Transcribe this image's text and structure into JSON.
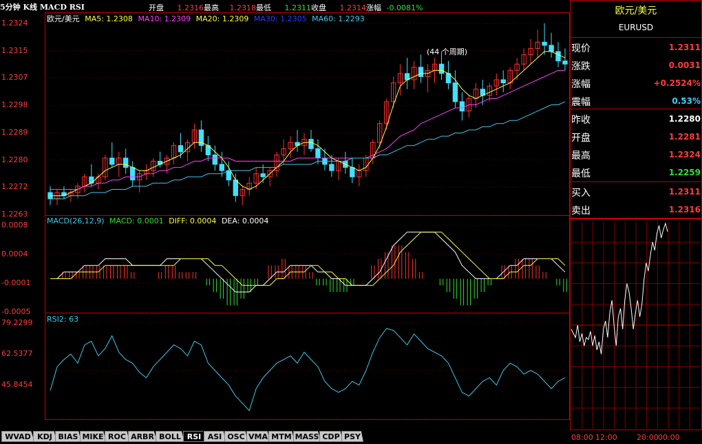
{
  "title": "5分钟 K线 MACD RSI",
  "header": {
    "open_label": "开盘",
    "open": "1.2316",
    "high_label": "最高",
    "high": "1.2318",
    "low_label": "最低",
    "low": "1.2311",
    "close_label": "收盘",
    "close": "1.2314",
    "change_label": "涨幅",
    "change": "-0.0081%"
  },
  "main_legend": {
    "symbol": "欧元/美元",
    "ma5": "MA5: 1.2308",
    "ma10": "MA10: 1.2309",
    "ma20": "MA20: 1.2309",
    "ma30": "MA30: 1.2305",
    "ma60": "MA60: 1.2293"
  },
  "period_note": "(44 个周期)",
  "macd_legend": {
    "name": "MACD(26,12,9)",
    "macd": "MACD: 0.0001",
    "diff": "DIFF: 0.0004",
    "dea": "DEA: 0.0004"
  },
  "rsi_legend": {
    "name": "RSI2: 63"
  },
  "side": {
    "name": "欧元/美元",
    "code": "EURUSD",
    "rows": [
      {
        "label": "现价",
        "value": "1.2311",
        "color": "#ff3b3b"
      },
      {
        "label": "涨跌",
        "value": "0.0031",
        "color": "#ff3b3b"
      },
      {
        "label": "涨幅",
        "value": "+0.2524%",
        "color": "#ff3b3b"
      },
      {
        "label": "震幅",
        "value": "0.53%",
        "color": "#40d0ff"
      },
      {
        "label": "昨收",
        "value": "1.2280",
        "color": "#ffffff"
      },
      {
        "label": "开盘",
        "value": "1.2281",
        "color": "#ff3b3b"
      },
      {
        "label": "最高",
        "value": "1.2324",
        "color": "#ff3b3b"
      },
      {
        "label": "最低",
        "value": "1.2259",
        "color": "#30e030"
      },
      {
        "label": "买入",
        "value": "1.2311",
        "color": "#ff3b3b"
      },
      {
        "label": "卖出",
        "value": "1.2316",
        "color": "#ff3b3b"
      }
    ],
    "time_start": "08:00",
    "time_mid": "12:00",
    "time_end": "20:00",
    "time_tail": "00:00"
  },
  "tabs": [
    "WVAD",
    "KDJ",
    "BIAS",
    "MIKE",
    "ROC",
    "ARBR",
    "BOLL",
    "RSI",
    "ASI",
    "OSC",
    "VMA",
    "MTM",
    "MASS",
    "CDP",
    "PSY"
  ],
  "active_tab": "RSI",
  "colors": {
    "up": "#ff3030",
    "down": "#40e0ff",
    "frame": "#c00000",
    "ma5": "#ffffff",
    "ma10": "#ffff40",
    "ma20": "#ff40ff",
    "ma30": "#00c000",
    "ma60": "#2040ff",
    "diff": "#ffffff",
    "dea": "#ffff40",
    "macd_up": "#ff3030",
    "macd_down": "#30e030",
    "rsi": "#40c8e8"
  },
  "chart_data": [
    {
      "type": "candlestick",
      "name": "欧元/美元",
      "yticks": [
        "1.2324",
        "1.2315",
        "1.2307",
        "1.2298",
        "1.2289",
        "1.2280",
        "1.2272",
        "1.2263"
      ],
      "ylim": [
        1.2263,
        1.2324
      ],
      "ohlc": [
        [
          1.227,
          1.2272,
          1.2266,
          1.2268
        ],
        [
          1.2268,
          1.2271,
          1.2266,
          1.227
        ],
        [
          1.227,
          1.2272,
          1.2268,
          1.2269
        ],
        [
          1.2269,
          1.2271,
          1.2267,
          1.227
        ],
        [
          1.227,
          1.2273,
          1.2268,
          1.2272
        ],
        [
          1.2272,
          1.2276,
          1.227,
          1.2275
        ],
        [
          1.2275,
          1.2279,
          1.2272,
          1.2273
        ],
        [
          1.2273,
          1.2276,
          1.2271,
          1.2275
        ],
        [
          1.2275,
          1.2282,
          1.2274,
          1.2281
        ],
        [
          1.2281,
          1.2286,
          1.2278,
          1.2279
        ],
        [
          1.2279,
          1.2283,
          1.2275,
          1.2281
        ],
        [
          1.2281,
          1.2284,
          1.2276,
          1.2278
        ],
        [
          1.2278,
          1.228,
          1.2272,
          1.2274
        ],
        [
          1.2274,
          1.2277,
          1.227,
          1.2276
        ],
        [
          1.2276,
          1.2279,
          1.2274,
          1.2277
        ],
        [
          1.2277,
          1.2281,
          1.2275,
          1.228
        ],
        [
          1.228,
          1.2283,
          1.2278,
          1.2279
        ],
        [
          1.2279,
          1.2282,
          1.2276,
          1.2281
        ],
        [
          1.2281,
          1.2286,
          1.2279,
          1.2285
        ],
        [
          1.2285,
          1.2289,
          1.2281,
          1.2283
        ],
        [
          1.2283,
          1.2287,
          1.228,
          1.2286
        ],
        [
          1.2286,
          1.2292,
          1.2284,
          1.229
        ],
        [
          1.229,
          1.2293,
          1.2283,
          1.2285
        ],
        [
          1.2285,
          1.2288,
          1.228,
          1.2282
        ],
        [
          1.2282,
          1.2285,
          1.2277,
          1.2279
        ],
        [
          1.2279,
          1.2283,
          1.2275,
          1.2277
        ],
        [
          1.2277,
          1.228,
          1.2272,
          1.2274
        ],
        [
          1.2274,
          1.2276,
          1.2267,
          1.2269
        ],
        [
          1.2269,
          1.2272,
          1.2266,
          1.2271
        ],
        [
          1.2271,
          1.2275,
          1.2269,
          1.2273
        ],
        [
          1.2273,
          1.2278,
          1.2271,
          1.2276
        ],
        [
          1.2276,
          1.2279,
          1.2273,
          1.2275
        ],
        [
          1.2275,
          1.2278,
          1.2272,
          1.2277
        ],
        [
          1.2277,
          1.2283,
          1.2275,
          1.2282
        ],
        [
          1.2282,
          1.2287,
          1.2279,
          1.2284
        ],
        [
          1.2284,
          1.2288,
          1.2281,
          1.2286
        ],
        [
          1.2286,
          1.229,
          1.2283,
          1.2285
        ],
        [
          1.2285,
          1.2289,
          1.2282,
          1.2287
        ],
        [
          1.2287,
          1.229,
          1.2283,
          1.2284
        ],
        [
          1.2284,
          1.2287,
          1.2279,
          1.2281
        ],
        [
          1.2281,
          1.2284,
          1.2277,
          1.2279
        ],
        [
          1.2279,
          1.2282,
          1.2275,
          1.2277
        ],
        [
          1.2277,
          1.2281,
          1.2274,
          1.228
        ],
        [
          1.228,
          1.2283,
          1.2276,
          1.2278
        ],
        [
          1.2278,
          1.2281,
          1.2273,
          1.2275
        ],
        [
          1.2275,
          1.2279,
          1.2272,
          1.2277
        ],
        [
          1.2277,
          1.2282,
          1.2275,
          1.2281
        ],
        [
          1.2281,
          1.2287,
          1.2279,
          1.2286
        ],
        [
          1.2286,
          1.2293,
          1.2284,
          1.2292
        ],
        [
          1.2292,
          1.23,
          1.229,
          1.2299
        ],
        [
          1.2299,
          1.2307,
          1.2297,
          1.2305
        ],
        [
          1.2305,
          1.2311,
          1.2301,
          1.2308
        ],
        [
          1.2308,
          1.2313,
          1.2303,
          1.2306
        ],
        [
          1.2306,
          1.2312,
          1.2303,
          1.231
        ],
        [
          1.231,
          1.2314,
          1.2305,
          1.2307
        ],
        [
          1.2307,
          1.2311,
          1.2302,
          1.2309
        ],
        [
          1.2309,
          1.2313,
          1.2305,
          1.2311
        ],
        [
          1.2311,
          1.2315,
          1.2306,
          1.2308
        ],
        [
          1.2308,
          1.2312,
          1.2303,
          1.2305
        ],
        [
          1.2305,
          1.2309,
          1.2297,
          1.2299
        ],
        [
          1.2299,
          1.2302,
          1.2293,
          1.2296
        ],
        [
          1.2296,
          1.2301,
          1.2294,
          1.23
        ],
        [
          1.23,
          1.2305,
          1.2297,
          1.2303
        ],
        [
          1.2303,
          1.2306,
          1.2298,
          1.2301
        ],
        [
          1.2301,
          1.2305,
          1.2299,
          1.2304
        ],
        [
          1.2304,
          1.2308,
          1.2301,
          1.2306
        ],
        [
          1.2306,
          1.2309,
          1.2302,
          1.2305
        ],
        [
          1.2305,
          1.231,
          1.2303,
          1.2309
        ],
        [
          1.2309,
          1.2313,
          1.2306,
          1.2311
        ],
        [
          1.2311,
          1.2316,
          1.2309,
          1.2314
        ],
        [
          1.2314,
          1.2319,
          1.2311,
          1.2316
        ],
        [
          1.2316,
          1.2322,
          1.2313,
          1.2318
        ],
        [
          1.2318,
          1.2324,
          1.2314,
          1.2317
        ],
        [
          1.2317,
          1.2321,
          1.2313,
          1.2315
        ],
        [
          1.2315,
          1.2318,
          1.231,
          1.2312
        ],
        [
          1.2312,
          1.2316,
          1.2309,
          1.2311
        ]
      ],
      "ma5": [
        1.2269,
        1.2269,
        1.2269,
        1.227,
        1.2271,
        1.2272,
        1.2273,
        1.2275,
        1.2277,
        1.2278,
        1.2279,
        1.2279,
        1.2278,
        1.2277,
        1.2277,
        1.2278,
        1.2279,
        1.228,
        1.2281,
        1.2282,
        1.2284,
        1.2286,
        1.2286,
        1.2285,
        1.2283,
        1.2281,
        1.2278,
        1.2274,
        1.2272,
        1.2271,
        1.2272,
        1.2274,
        1.2276,
        1.2278,
        1.228,
        1.2283,
        1.2285,
        1.2286,
        1.2286,
        1.2285,
        1.2283,
        1.2281,
        1.228,
        1.2279,
        1.2278,
        1.2277,
        1.2278,
        1.2281,
        1.2285,
        1.2291,
        1.2298,
        1.2304,
        1.2306,
        1.2307,
        1.2308,
        1.2308,
        1.2309,
        1.2309,
        1.2308,
        1.2306,
        1.2303,
        1.2301,
        1.23,
        1.2301,
        1.2302,
        1.2303,
        1.2304,
        1.2305,
        1.2307,
        1.2309,
        1.2311,
        1.2313,
        1.2315,
        1.2315,
        1.2314,
        1.2313
      ],
      "ma20": [
        1.2271,
        1.2271,
        1.2271,
        1.2271,
        1.2271,
        1.2272,
        1.2272,
        1.2273,
        1.2273,
        1.2274,
        1.2274,
        1.2275,
        1.2275,
        1.2275,
        1.2276,
        1.2276,
        1.2277,
        1.2277,
        1.2278,
        1.2278,
        1.2279,
        1.228,
        1.228,
        1.2281,
        1.2281,
        1.2281,
        1.2281,
        1.228,
        1.228,
        1.228,
        1.228,
        1.228,
        1.228,
        1.228,
        1.228,
        1.228,
        1.2281,
        1.2281,
        1.2281,
        1.2281,
        1.2281,
        1.2281,
        1.2281,
        1.2281,
        1.2281,
        1.2281,
        1.2281,
        1.2282,
        1.2283,
        1.2284,
        1.2286,
        1.2288,
        1.2289,
        1.229,
        1.2292,
        1.2293,
        1.2294,
        1.2295,
        1.2296,
        1.2297,
        1.2297,
        1.2298,
        1.2298,
        1.2299,
        1.23,
        1.23,
        1.2301,
        1.2302,
        1.2303,
        1.2304,
        1.2305,
        1.2306,
        1.2307,
        1.2308,
        1.2309,
        1.2309
      ],
      "ma60": [
        1.2268,
        1.2268,
        1.2268,
        1.2269,
        1.2269,
        1.2269,
        1.227,
        1.227,
        1.227,
        1.2271,
        1.2271,
        1.2271,
        1.2272,
        1.2272,
        1.2272,
        1.2273,
        1.2273,
        1.2273,
        1.2274,
        1.2274,
        1.2275,
        1.2275,
        1.2275,
        1.2276,
        1.2276,
        1.2276,
        1.2277,
        1.2277,
        1.2277,
        1.2277,
        1.2278,
        1.2278,
        1.2278,
        1.2278,
        1.2279,
        1.2279,
        1.2279,
        1.2279,
        1.2279,
        1.228,
        1.228,
        1.228,
        1.228,
        1.228,
        1.2281,
        1.2281,
        1.2281,
        1.2281,
        1.2282,
        1.2282,
        1.2283,
        1.2284,
        1.2285,
        1.2285,
        1.2286,
        1.2287,
        1.2287,
        1.2288,
        1.2288,
        1.2289,
        1.2289,
        1.229,
        1.229,
        1.2291,
        1.2291,
        1.2292,
        1.2292,
        1.2293,
        1.2293,
        1.2294,
        1.2295,
        1.2296,
        1.2297,
        1.2298,
        1.2298,
        1.2299
      ]
    },
    {
      "type": "macd",
      "name": "MACD(26,12,9)",
      "yticks": [
        "0.0008",
        "0.0004",
        "-0.0001",
        "-0.0005"
      ],
      "ylim": [
        -0.0005,
        0.0008
      ],
      "diff": [
        0.0,
        0.0,
        0.0001,
        0.0001,
        0.0001,
        0.0002,
        0.0002,
        0.0002,
        0.0003,
        0.0003,
        0.0003,
        0.0003,
        0.0002,
        0.0002,
        0.0002,
        0.0002,
        0.0002,
        0.0003,
        0.0003,
        0.0003,
        0.0003,
        0.0003,
        0.0003,
        0.0002,
        0.0001,
        0.0,
        -0.0001,
        -0.0002,
        -0.0002,
        -0.0002,
        -0.0001,
        -0.0001,
        0.0,
        0.0001,
        0.0001,
        0.0002,
        0.0002,
        0.0002,
        0.0002,
        0.0001,
        0.0001,
        0.0,
        0.0,
        -0.0001,
        -0.0001,
        -0.0001,
        -0.0001,
        0.0,
        0.0001,
        0.0003,
        0.0005,
        0.0006,
        0.0007,
        0.0007,
        0.0007,
        0.0007,
        0.0007,
        0.0006,
        0.0005,
        0.0004,
        0.0002,
        0.0001,
        0.0,
        0.0,
        0.0,
        0.0,
        0.0001,
        0.0002,
        0.0002,
        0.0003,
        0.0003,
        0.0003,
        0.0003,
        0.0003,
        0.0002,
        0.0001
      ],
      "dea": [
        0.0,
        0.0,
        0.0,
        0.0,
        0.0001,
        0.0001,
        0.0001,
        0.0001,
        0.0002,
        0.0002,
        0.0002,
        0.0002,
        0.0002,
        0.0002,
        0.0002,
        0.0002,
        0.0002,
        0.0002,
        0.0002,
        0.0003,
        0.0003,
        0.0003,
        0.0003,
        0.0003,
        0.0002,
        0.0002,
        0.0001,
        0.0,
        -0.0001,
        -0.0001,
        -0.0001,
        -0.0001,
        -0.0001,
        0.0,
        0.0,
        0.0001,
        0.0001,
        0.0001,
        0.0002,
        0.0002,
        0.0001,
        0.0001,
        0.0,
        0.0,
        -0.0001,
        -0.0001,
        -0.0001,
        -0.0001,
        0.0,
        0.0001,
        0.0002,
        0.0004,
        0.0005,
        0.0006,
        0.0007,
        0.0007,
        0.0007,
        0.0007,
        0.0006,
        0.0005,
        0.0004,
        0.0003,
        0.0002,
        0.0001,
        0.0,
        0.0,
        0.0,
        0.0001,
        0.0001,
        0.0002,
        0.0002,
        0.0003,
        0.0003,
        0.0003,
        0.0003,
        0.0002
      ],
      "macd": [
        0.0,
        0.0,
        0.0001,
        0.0001,
        0.0001,
        0.0002,
        0.0002,
        0.0002,
        0.0002,
        0.0002,
        0.0002,
        0.0002,
        0.0001,
        0.0,
        0.0,
        0.0,
        0.0001,
        0.0002,
        0.0002,
        0.0001,
        0.0001,
        0.0001,
        0.0,
        -0.0001,
        -0.0002,
        -0.0003,
        -0.0004,
        -0.0004,
        -0.0003,
        -0.0002,
        -0.0001,
        0.0,
        0.0002,
        0.0002,
        0.0003,
        0.0002,
        0.0002,
        0.0002,
        0.0001,
        -0.0001,
        -0.0001,
        -0.0002,
        -0.0002,
        -0.0002,
        -0.0001,
        0.0,
        0.0,
        0.0002,
        0.0003,
        0.0004,
        0.0005,
        0.0005,
        0.0004,
        0.0003,
        0.0001,
        0.0,
        0.0,
        -0.0001,
        -0.0002,
        -0.0003,
        -0.0004,
        -0.0004,
        -0.0003,
        -0.0002,
        -0.0001,
        0.0,
        0.0002,
        0.0002,
        0.0003,
        0.0003,
        0.0003,
        0.0002,
        0.0001,
        0.0,
        -0.0001,
        -0.0002
      ]
    },
    {
      "type": "line",
      "name": "RSI2",
      "yticks": [
        "79.2299",
        "62.5377",
        "45.8454"
      ],
      "ylim": [
        30,
        82
      ],
      "values": [
        45,
        58,
        62,
        65,
        60,
        70,
        72,
        64,
        68,
        75,
        66,
        62,
        60,
        55,
        52,
        58,
        62,
        66,
        70,
        68,
        64,
        72,
        70,
        60,
        56,
        52,
        48,
        42,
        38,
        34,
        46,
        52,
        56,
        60,
        62,
        64,
        60,
        66,
        62,
        58,
        50,
        46,
        44,
        46,
        50,
        48,
        56,
        66,
        74,
        79,
        78,
        74,
        70,
        76,
        72,
        68,
        66,
        64,
        60,
        52,
        44,
        42,
        46,
        50,
        52,
        48,
        56,
        60,
        58,
        54,
        56,
        54,
        50,
        46,
        50,
        52
      ]
    },
    {
      "type": "line",
      "name": "intraday",
      "xticks": [
        "08:00",
        "12:00",
        "20:00",
        "00:00"
      ],
      "values": [
        0.48,
        0.46,
        0.44,
        0.5,
        0.42,
        0.46,
        0.4,
        0.44,
        0.43,
        0.47,
        0.4,
        0.45,
        0.38,
        0.42,
        0.36,
        0.48,
        0.52,
        0.44,
        0.56,
        0.62,
        0.5,
        0.4,
        0.54,
        0.58,
        0.48,
        0.62,
        0.7,
        0.66,
        0.58,
        0.48,
        0.56,
        0.62,
        0.54,
        0.6,
        0.72,
        0.8,
        0.76,
        0.84,
        0.9,
        0.86,
        0.94,
        0.98,
        0.92,
        0.96,
        0.99,
        0.95
      ]
    }
  ]
}
